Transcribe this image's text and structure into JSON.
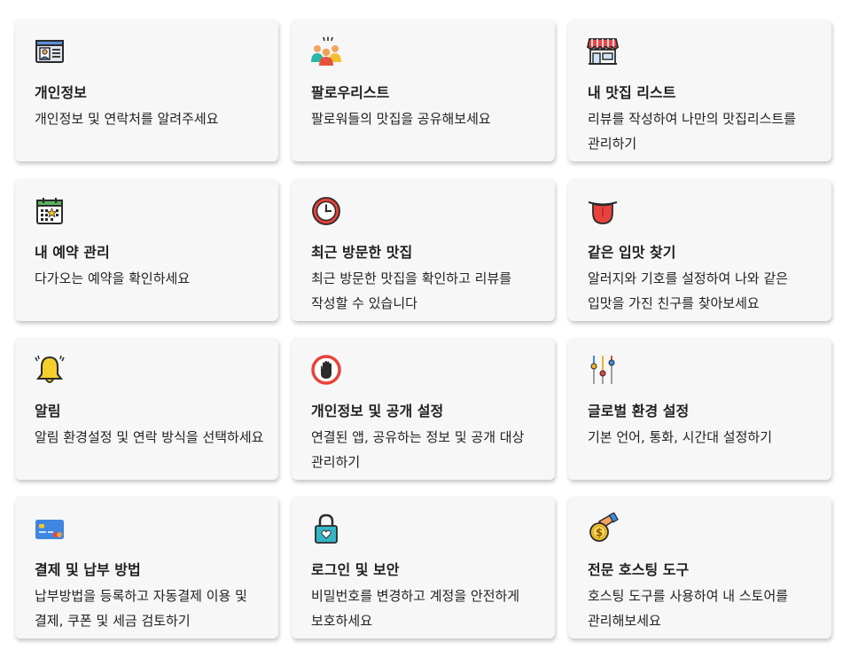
{
  "cards": [
    {
      "title": "개인정보",
      "desc": "개인정보 및 연락처를 알려주세요",
      "icon": "id-card-icon"
    },
    {
      "title": "팔로우리스트",
      "desc": "팔로워들의 맛집을 공유해보세요",
      "icon": "people-group-icon"
    },
    {
      "title": "내 맛집 리스트",
      "desc": "리뷰를 작성하여 나만의 맛집리스트를 관리하기",
      "icon": "store-icon"
    },
    {
      "title": "내 예약 관리",
      "desc": "다가오는 예약을 확인하세요",
      "icon": "calendar-icon"
    },
    {
      "title": "최근 방문한 맛집",
      "desc": "최근 방문한 맛집을 확인하고 리뷰를 작성할 수 있습니다",
      "icon": "clock-icon"
    },
    {
      "title": "같은 입맛 찾기",
      "desc": "알러지와 기호를 설정하여 나와 같은 입맛을 가진 친구를 찾아보세요",
      "icon": "tongue-icon"
    },
    {
      "title": "알림",
      "desc": "알림 환경설정 및 연락 방식을 선택하세요",
      "icon": "bell-icon"
    },
    {
      "title": "개인정보 및 공개 설정",
      "desc": "연결된 앱, 공유하는 정보 및 공개 대상 관리하기",
      "icon": "stop-hand-icon"
    },
    {
      "title": "글로벌 환경 설정",
      "desc": "기본 언어, 통화, 시간대 설정하기",
      "icon": "sliders-icon"
    },
    {
      "title": "결제 및 납부 방법",
      "desc": "납부방법을 등록하고 자동결제 이용 및 결제, 쿠폰 및 세금 검토하기",
      "icon": "credit-card-icon"
    },
    {
      "title": "로그인 및 보안",
      "desc": "비밀번호를 변경하고 계정을 안전하게 보호하세요",
      "icon": "padlock-icon"
    },
    {
      "title": "전문 호스팅 도구",
      "desc": "호스팅 도구를 사용하여 내 스토어를 관리해보세요",
      "icon": "hand-coin-icon"
    }
  ]
}
